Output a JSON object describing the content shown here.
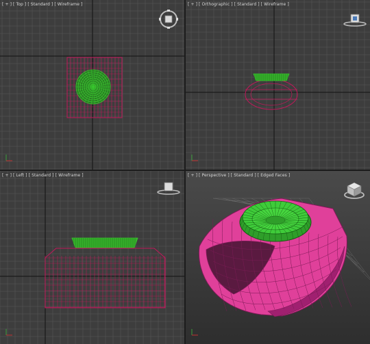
{
  "viewports": [
    {
      "id": "top",
      "label": "[ + ] [ Top ] [ Standard ] [ Wireframe ]",
      "view": "Top",
      "active": false
    },
    {
      "id": "front",
      "label": "[ + ] [ Orthographic ] [ Standard ] [ Wireframe ]",
      "view": "Orthographic",
      "active": false
    },
    {
      "id": "left",
      "label": "[ + ] [ Left ] [ Standard ] [ Wireframe ]",
      "view": "Left",
      "active": false
    },
    {
      "id": "persp",
      "label": "[ + ] [ Perspective ] [ Standard ] [ Edged Faces ]",
      "view": "Perspective",
      "active": true
    }
  ],
  "colors": {
    "viewport_bg": "#3d3d3d",
    "grid": "#5a5a5a",
    "grid_axis": "#111111",
    "band_wire": "#c2185b",
    "gem_wire": "#39c92e",
    "band_shaded": "#e0409a",
    "gem_shaded": "#3fcc3a",
    "active_border": "#d7b44a"
  },
  "icons": {
    "viewcube": "viewcube-icon",
    "axis": "axis-tripod-icon"
  }
}
